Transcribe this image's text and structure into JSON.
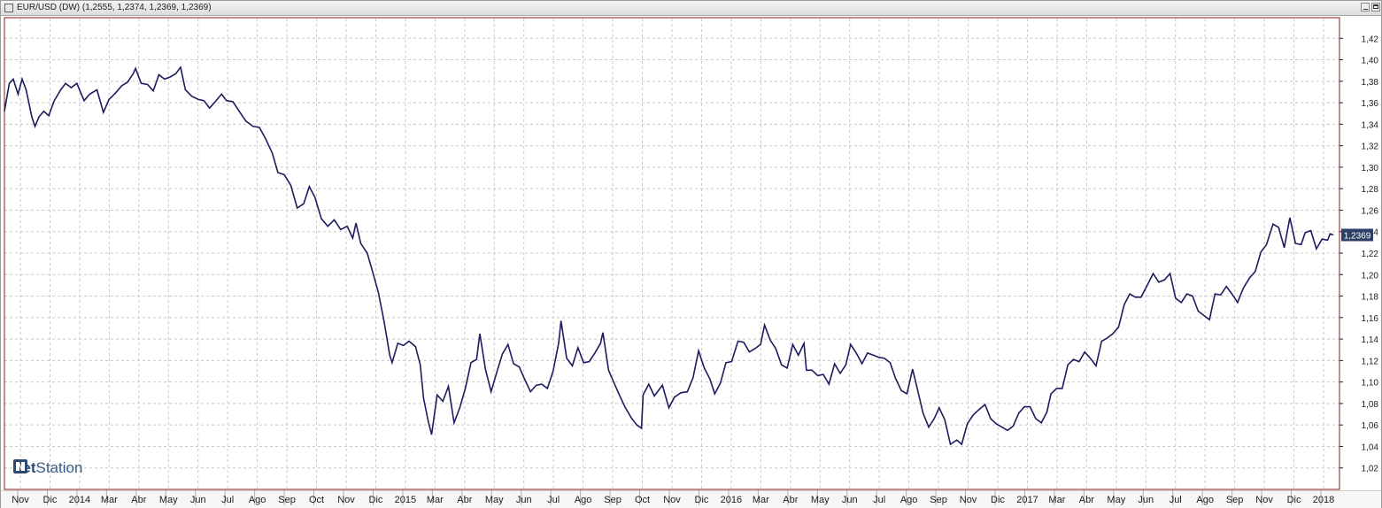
{
  "window": {
    "title": "EUR/USD (DW) (1,2555, 1,2374, 1,2369, 1,2369)"
  },
  "logo": {
    "net": "net",
    "station": "Station"
  },
  "colors": {
    "line": "#1c1c5e",
    "grid": "#c8c8c8",
    "axis_frame": "#8b1a1a",
    "price_tag": "#2d3f66"
  },
  "chart_data": {
    "type": "line",
    "title": "EUR/USD (DW) (1,2555, 1,2374, 1,2369, 1,2369)",
    "xlabel": "",
    "ylabel": "",
    "ylim": [
      1.0,
      1.44
    ],
    "y_ticks": [
      "1,02",
      "1,04",
      "1,06",
      "1,08",
      "1,10",
      "1,12",
      "1,14",
      "1,16",
      "1,18",
      "1,20",
      "1,22",
      "1,24",
      "1,26",
      "1,28",
      "1,30",
      "1,32",
      "1,34",
      "1,36",
      "1,38",
      "1,40",
      "1,42"
    ],
    "x_ticks": [
      "Nov",
      "Dic",
      "2014",
      "Mar",
      "Abr",
      "May",
      "Jun",
      "Jul",
      "Ago",
      "Sep",
      "Oct",
      "Nov",
      "Dic",
      "2015",
      "Mar",
      "Abr",
      "May",
      "Jun",
      "Jul",
      "Ago",
      "Sep",
      "Oct",
      "Nov",
      "Dic",
      "2016",
      "Mar",
      "Abr",
      "May",
      "Jun",
      "Jul",
      "Ago",
      "Sep",
      "Nov",
      "Dic",
      "2017",
      "Mar",
      "Abr",
      "May",
      "Jun",
      "Jul",
      "Ago",
      "Sep",
      "Nov",
      "Dic",
      "2018"
    ],
    "last_price_label": "1,2369",
    "grid": true,
    "series": [
      {
        "values": [
          [
            "2013-10-01",
            1.352
          ],
          [
            "2013-10-07",
            1.378
          ],
          [
            "2013-10-12",
            1.382
          ],
          [
            "2013-10-18",
            1.368
          ],
          [
            "2013-10-23",
            1.382
          ],
          [
            "2013-10-28",
            1.372
          ],
          [
            "2013-11-04",
            1.347
          ],
          [
            "2013-11-08",
            1.338
          ],
          [
            "2013-11-13",
            1.347
          ],
          [
            "2013-11-19",
            1.352
          ],
          [
            "2013-11-25",
            1.348
          ],
          [
            "2013-12-02",
            1.362
          ],
          [
            "2013-12-10",
            1.372
          ],
          [
            "2013-12-16",
            1.378
          ],
          [
            "2013-12-23",
            1.374
          ],
          [
            "2013-12-30",
            1.378
          ],
          [
            "2014-01-08",
            1.362
          ],
          [
            "2014-01-15",
            1.368
          ],
          [
            "2014-01-24",
            1.372
          ],
          [
            "2014-02-01",
            1.351
          ],
          [
            "2014-02-08",
            1.363
          ],
          [
            "2014-02-16",
            1.369
          ],
          [
            "2014-02-24",
            1.376
          ],
          [
            "2014-03-03",
            1.379
          ],
          [
            "2014-03-10",
            1.387
          ],
          [
            "2014-03-13",
            1.392
          ],
          [
            "2014-03-20",
            1.378
          ],
          [
            "2014-03-28",
            1.377
          ],
          [
            "2014-04-04",
            1.371
          ],
          [
            "2014-04-11",
            1.386
          ],
          [
            "2014-04-18",
            1.382
          ],
          [
            "2014-04-25",
            1.384
          ],
          [
            "2014-05-02",
            1.387
          ],
          [
            "2014-05-08",
            1.393
          ],
          [
            "2014-05-14",
            1.372
          ],
          [
            "2014-05-22",
            1.366
          ],
          [
            "2014-05-30",
            1.363
          ],
          [
            "2014-06-06",
            1.362
          ],
          [
            "2014-06-13",
            1.355
          ],
          [
            "2014-06-20",
            1.361
          ],
          [
            "2014-06-28",
            1.368
          ],
          [
            "2014-07-04",
            1.362
          ],
          [
            "2014-07-12",
            1.361
          ],
          [
            "2014-07-20",
            1.352
          ],
          [
            "2014-07-28",
            1.343
          ],
          [
            "2014-08-06",
            1.338
          ],
          [
            "2014-08-14",
            1.337
          ],
          [
            "2014-08-22",
            1.326
          ],
          [
            "2014-08-30",
            1.313
          ],
          [
            "2014-09-06",
            1.295
          ],
          [
            "2014-09-14",
            1.293
          ],
          [
            "2014-09-22",
            1.283
          ],
          [
            "2014-09-30",
            1.262
          ],
          [
            "2014-10-08",
            1.266
          ],
          [
            "2014-10-15",
            1.282
          ],
          [
            "2014-10-22",
            1.272
          ],
          [
            "2014-10-30",
            1.252
          ],
          [
            "2014-11-07",
            1.245
          ],
          [
            "2014-11-15",
            1.251
          ],
          [
            "2014-11-23",
            1.242
          ],
          [
            "2014-12-01",
            1.245
          ],
          [
            "2014-12-08",
            1.234
          ],
          [
            "2014-12-12",
            1.248
          ],
          [
            "2014-12-18",
            1.229
          ],
          [
            "2014-12-26",
            1.22
          ],
          [
            "2015-01-02",
            1.202
          ],
          [
            "2015-01-09",
            1.183
          ],
          [
            "2015-01-16",
            1.156
          ],
          [
            "2015-01-23",
            1.125
          ],
          [
            "2015-01-26",
            1.118
          ],
          [
            "2015-02-02",
            1.136
          ],
          [
            "2015-02-09",
            1.134
          ],
          [
            "2015-02-16",
            1.138
          ],
          [
            "2015-02-24",
            1.133
          ],
          [
            "2015-03-02",
            1.116
          ],
          [
            "2015-03-06",
            1.085
          ],
          [
            "2015-03-12",
            1.063
          ],
          [
            "2015-03-16",
            1.051
          ],
          [
            "2015-03-23",
            1.088
          ],
          [
            "2015-03-30",
            1.082
          ],
          [
            "2015-04-06",
            1.096
          ],
          [
            "2015-04-13",
            1.062
          ],
          [
            "2015-04-20",
            1.076
          ],
          [
            "2015-04-27",
            1.094
          ],
          [
            "2015-05-04",
            1.118
          ],
          [
            "2015-05-11",
            1.121
          ],
          [
            "2015-05-15",
            1.145
          ],
          [
            "2015-05-22",
            1.112
          ],
          [
            "2015-05-29",
            1.091
          ],
          [
            "2015-06-05",
            1.109
          ],
          [
            "2015-06-12",
            1.126
          ],
          [
            "2015-06-19",
            1.135
          ],
          [
            "2015-06-26",
            1.117
          ],
          [
            "2015-07-03",
            1.114
          ],
          [
            "2015-07-10",
            1.102
          ],
          [
            "2015-07-17",
            1.091
          ],
          [
            "2015-07-24",
            1.097
          ],
          [
            "2015-07-31",
            1.098
          ],
          [
            "2015-08-07",
            1.094
          ],
          [
            "2015-08-14",
            1.11
          ],
          [
            "2015-08-21",
            1.136
          ],
          [
            "2015-08-24",
            1.157
          ],
          [
            "2015-08-31",
            1.122
          ],
          [
            "2015-09-07",
            1.115
          ],
          [
            "2015-09-14",
            1.132
          ],
          [
            "2015-09-21",
            1.118
          ],
          [
            "2015-09-28",
            1.119
          ],
          [
            "2015-10-05",
            1.127
          ],
          [
            "2015-10-12",
            1.136
          ],
          [
            "2015-10-15",
            1.146
          ],
          [
            "2015-10-22",
            1.111
          ],
          [
            "2015-10-29",
            1.099
          ],
          [
            "2015-11-05",
            1.087
          ],
          [
            "2015-11-12",
            1.076
          ],
          [
            "2015-11-19",
            1.067
          ],
          [
            "2015-11-26",
            1.06
          ],
          [
            "2015-12-02",
            1.057
          ],
          [
            "2015-12-04",
            1.088
          ],
          [
            "2015-12-11",
            1.098
          ],
          [
            "2015-12-18",
            1.087
          ],
          [
            "2015-12-28",
            1.097
          ],
          [
            "2016-01-05",
            1.076
          ],
          [
            "2016-01-12",
            1.086
          ],
          [
            "2016-01-20",
            1.09
          ],
          [
            "2016-01-28",
            1.091
          ],
          [
            "2016-02-04",
            1.104
          ],
          [
            "2016-02-11",
            1.129
          ],
          [
            "2016-02-18",
            1.113
          ],
          [
            "2016-02-25",
            1.103
          ],
          [
            "2016-03-02",
            1.089
          ],
          [
            "2016-03-09",
            1.099
          ],
          [
            "2016-03-16",
            1.118
          ],
          [
            "2016-03-23",
            1.119
          ],
          [
            "2016-03-31",
            1.138
          ],
          [
            "2016-04-07",
            1.137
          ],
          [
            "2016-04-14",
            1.128
          ],
          [
            "2016-04-21",
            1.131
          ],
          [
            "2016-04-28",
            1.135
          ],
          [
            "2016-05-03",
            1.153
          ],
          [
            "2016-05-10",
            1.139
          ],
          [
            "2016-05-17",
            1.131
          ],
          [
            "2016-05-24",
            1.116
          ],
          [
            "2016-05-31",
            1.113
          ],
          [
            "2016-06-07",
            1.135
          ],
          [
            "2016-06-14",
            1.125
          ],
          [
            "2016-06-21",
            1.136
          ],
          [
            "2016-06-24",
            1.111
          ],
          [
            "2016-07-01",
            1.111
          ],
          [
            "2016-07-08",
            1.106
          ],
          [
            "2016-07-15",
            1.107
          ],
          [
            "2016-07-22",
            1.098
          ],
          [
            "2016-07-29",
            1.117
          ],
          [
            "2016-08-05",
            1.108
          ],
          [
            "2016-08-12",
            1.116
          ],
          [
            "2016-08-18",
            1.135
          ],
          [
            "2016-08-25",
            1.127
          ],
          [
            "2016-09-01",
            1.117
          ],
          [
            "2016-09-08",
            1.127
          ],
          [
            "2016-09-15",
            1.125
          ],
          [
            "2016-09-22",
            1.123
          ],
          [
            "2016-09-29",
            1.122
          ],
          [
            "2016-10-06",
            1.118
          ],
          [
            "2016-10-13",
            1.103
          ],
          [
            "2016-10-20",
            1.092
          ],
          [
            "2016-10-27",
            1.089
          ],
          [
            "2016-11-03",
            1.112
          ],
          [
            "2016-11-09",
            1.093
          ],
          [
            "2016-11-16",
            1.071
          ],
          [
            "2016-11-23",
            1.058
          ],
          [
            "2016-11-30",
            1.066
          ],
          [
            "2016-12-06",
            1.076
          ],
          [
            "2016-12-13",
            1.065
          ],
          [
            "2016-12-20",
            1.042
          ],
          [
            "2016-12-28",
            1.046
          ],
          [
            "2017-01-03",
            1.042
          ],
          [
            "2017-01-10",
            1.061
          ],
          [
            "2017-01-17",
            1.069
          ],
          [
            "2017-01-24",
            1.074
          ],
          [
            "2017-02-01",
            1.079
          ],
          [
            "2017-02-08",
            1.066
          ],
          [
            "2017-02-15",
            1.061
          ],
          [
            "2017-02-22",
            1.058
          ],
          [
            "2017-03-01",
            1.055
          ],
          [
            "2017-03-08",
            1.059
          ],
          [
            "2017-03-15",
            1.071
          ],
          [
            "2017-03-22",
            1.077
          ],
          [
            "2017-03-29",
            1.077
          ],
          [
            "2017-04-05",
            1.066
          ],
          [
            "2017-04-12",
            1.062
          ],
          [
            "2017-04-19",
            1.072
          ],
          [
            "2017-04-24",
            1.089
          ],
          [
            "2017-05-01",
            1.094
          ],
          [
            "2017-05-08",
            1.094
          ],
          [
            "2017-05-15",
            1.116
          ],
          [
            "2017-05-22",
            1.121
          ],
          [
            "2017-05-29",
            1.119
          ],
          [
            "2017-06-05",
            1.128
          ],
          [
            "2017-06-12",
            1.122
          ],
          [
            "2017-06-19",
            1.115
          ],
          [
            "2017-06-26",
            1.138
          ],
          [
            "2017-07-03",
            1.141
          ],
          [
            "2017-07-10",
            1.145
          ],
          [
            "2017-07-17",
            1.151
          ],
          [
            "2017-07-24",
            1.172
          ],
          [
            "2017-07-31",
            1.182
          ],
          [
            "2017-08-07",
            1.179
          ],
          [
            "2017-08-14",
            1.179
          ],
          [
            "2017-08-21",
            1.189
          ],
          [
            "2017-08-29",
            1.201
          ],
          [
            "2017-09-05",
            1.193
          ],
          [
            "2017-09-12",
            1.195
          ],
          [
            "2017-09-19",
            1.201
          ],
          [
            "2017-09-26",
            1.178
          ],
          [
            "2017-10-03",
            1.174
          ],
          [
            "2017-10-10",
            1.182
          ],
          [
            "2017-10-17",
            1.18
          ],
          [
            "2017-10-24",
            1.166
          ],
          [
            "2017-10-31",
            1.162
          ],
          [
            "2017-11-07",
            1.158
          ],
          [
            "2017-11-14",
            1.182
          ],
          [
            "2017-11-21",
            1.181
          ],
          [
            "2017-11-28",
            1.189
          ],
          [
            "2017-12-05",
            1.182
          ],
          [
            "2017-12-12",
            1.174
          ],
          [
            "2017-12-19",
            1.187
          ],
          [
            "2017-12-27",
            1.197
          ],
          [
            "2018-01-03",
            1.203
          ],
          [
            "2018-01-10",
            1.221
          ],
          [
            "2018-01-17",
            1.228
          ],
          [
            "2018-01-25",
            1.247
          ],
          [
            "2018-02-01",
            1.244
          ],
          [
            "2018-02-08",
            1.225
          ],
          [
            "2018-02-15",
            1.253
          ],
          [
            "2018-02-22",
            1.229
          ],
          [
            "2018-03-01",
            1.228
          ],
          [
            "2018-03-06",
            1.239
          ],
          [
            "2018-03-13",
            1.241
          ],
          [
            "2018-03-20",
            1.224
          ],
          [
            "2018-03-27",
            1.233
          ],
          [
            "2018-04-03",
            1.232
          ],
          [
            "2018-04-06",
            1.238
          ],
          [
            "2018-04-10",
            1.2369
          ]
        ]
      }
    ]
  }
}
